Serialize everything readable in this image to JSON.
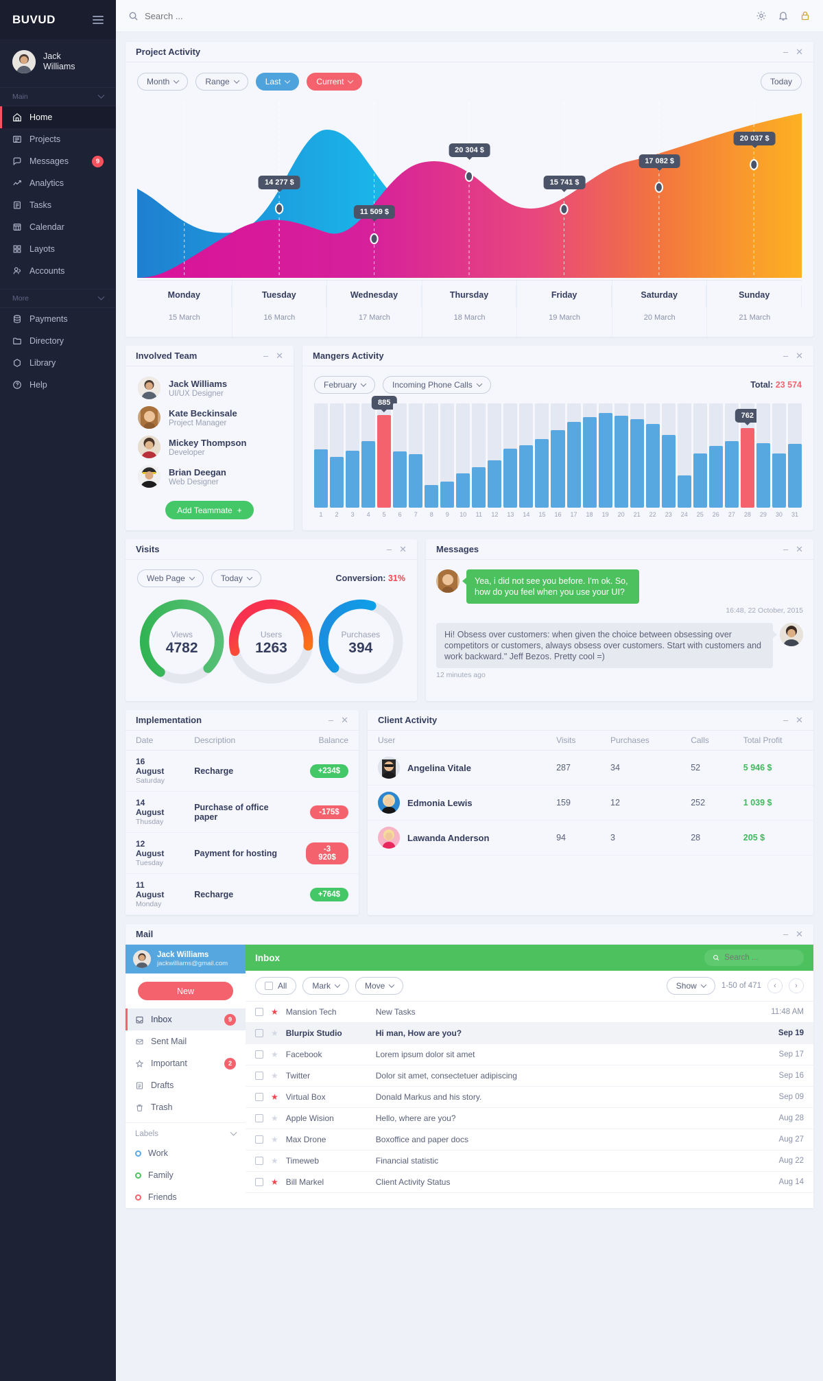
{
  "brand": {
    "logo": "BUVUD"
  },
  "profile": {
    "name": "Jack\nWilliams"
  },
  "sidebar": {
    "section_main": "Main",
    "section_more": "More",
    "items": [
      {
        "label": "Home",
        "icon": "home-icon",
        "active": true
      },
      {
        "label": "Projects",
        "icon": "projects-icon"
      },
      {
        "label": "Messages",
        "icon": "messages-icon",
        "badge": "9"
      },
      {
        "label": "Analytics",
        "icon": "analytics-icon"
      },
      {
        "label": "Tasks",
        "icon": "tasks-icon"
      },
      {
        "label": "Calendar",
        "icon": "calendar-icon"
      },
      {
        "label": "Layots",
        "icon": "layouts-icon"
      },
      {
        "label": "Accounts",
        "icon": "accounts-icon"
      }
    ],
    "more_items": [
      {
        "label": "Payments",
        "icon": "payments-icon"
      },
      {
        "label": "Directory",
        "icon": "directory-icon"
      },
      {
        "label": "Library",
        "icon": "library-icon"
      },
      {
        "label": "Help",
        "icon": "help-icon"
      }
    ]
  },
  "topbar": {
    "search_placeholder": "Search ...",
    "icons": [
      "gear-icon",
      "bell-icon",
      "lock-icon"
    ]
  },
  "project_activity": {
    "title": "Project Activity",
    "filters": [
      {
        "label": "Month",
        "style": "outline"
      },
      {
        "label": "Range",
        "style": "outline"
      },
      {
        "label": "Last",
        "style": "blue"
      },
      {
        "label": "Current",
        "style": "red"
      }
    ],
    "today_label": "Today"
  },
  "involved_team": {
    "title": "Involved Team",
    "members": [
      {
        "name": "Jack Williams",
        "role": "UI/UX Designer"
      },
      {
        "name": "Kate Beckinsale",
        "role": "Project Manager"
      },
      {
        "name": "Mickey Thompson",
        "role": "Developer"
      },
      {
        "name": "Brian Deegan",
        "role": "Web Designer"
      }
    ],
    "add_label": "Add Teammate"
  },
  "managers_activity": {
    "title": "Mangers Activity",
    "filters": [
      {
        "label": "February"
      },
      {
        "label": "Incoming Phone Calls"
      }
    ],
    "total_label": "Total:",
    "total_value": "23 574"
  },
  "visits": {
    "title": "Visits",
    "filters": [
      {
        "label": "Web Page"
      },
      {
        "label": "Today"
      }
    ],
    "conversion_label": "Conversion:",
    "conversion_value": "31%",
    "donuts": [
      {
        "label": "Views",
        "value": "4782",
        "pct": 78,
        "c1": "#2bb24c",
        "c2": "#5fc27e"
      },
      {
        "label": "Users",
        "value": "1263",
        "pct": 56,
        "c1": "#fb8c00",
        "c2": "#f8314f"
      },
      {
        "label": "Purchases",
        "value": "394",
        "pct": 42,
        "c1": "#00b2f0",
        "c2": "#1a8fe0"
      }
    ]
  },
  "messages": {
    "title": "Messages",
    "items": [
      {
        "side": "right",
        "text": "Yea, i did not see you before. I'm ok. So, how do you feel when you use your UI?",
        "time": "16:48, 22 October, 2015"
      },
      {
        "side": "left",
        "text": "Hi! Obsess over customers: when given the choice between obsessing over competitors or customers, always obsess over customers. Start with customers and work backward.\" Jeff Bezos. Pretty cool =)",
        "time": "12 minutes ago"
      }
    ]
  },
  "implementation": {
    "title": "Implementation",
    "columns": [
      "Date",
      "Description",
      "Balance"
    ],
    "rows": [
      {
        "date": "16 August",
        "day": "Saturday",
        "desc": "Recharge",
        "balance": "+234$",
        "sign": "p"
      },
      {
        "date": "14 August",
        "day": "Thusday",
        "desc": "Purchase of office paper",
        "balance": "-175$",
        "sign": "n"
      },
      {
        "date": "12 August",
        "day": "Tuesday",
        "desc": "Payment for hosting",
        "balance": "-3 920$",
        "sign": "n"
      },
      {
        "date": "11 August",
        "day": "Monday",
        "desc": "Recharge",
        "balance": "+764$",
        "sign": "p"
      }
    ]
  },
  "client_activity": {
    "title": "Client Activity",
    "columns": [
      "User",
      "Visits",
      "Purchases",
      "Calls",
      "Total Profit"
    ],
    "rows": [
      {
        "name": "Angelina Vitale",
        "visits": "287",
        "purchases": "34",
        "calls": "52",
        "profit": "5 946 $"
      },
      {
        "name": "Edmonia Lewis",
        "visits": "159",
        "purchases": "12",
        "calls": "252",
        "profit": "1 039 $"
      },
      {
        "name": "Lawanda Anderson",
        "visits": "94",
        "purchases": "3",
        "calls": "28",
        "profit": "205 $"
      }
    ]
  },
  "mail": {
    "title": "Mail",
    "user_name": "Jack Williams",
    "user_email": "jackwilliams@gmail.com",
    "new_label": "New",
    "folders": [
      {
        "label": "Inbox",
        "icon": "inbox-icon",
        "badge": "9",
        "active": true
      },
      {
        "label": "Sent Mail",
        "icon": "sent-icon"
      },
      {
        "label": "Important",
        "icon": "star-icon",
        "badge": "2"
      },
      {
        "label": "Drafts",
        "icon": "drafts-icon"
      },
      {
        "label": "Trash",
        "icon": "trash-icon"
      }
    ],
    "labels_title": "Labels",
    "labels": [
      {
        "label": "Work",
        "color": "#5aa9e6"
      },
      {
        "label": "Family",
        "color": "#4ec15f"
      },
      {
        "label": "Friends",
        "color": "#f4636d"
      }
    ],
    "inbox_title": "Inbox",
    "search_placeholder": "Search ...",
    "toolbar": [
      {
        "label": "All",
        "type": "checkbox"
      },
      {
        "label": "Mark",
        "type": "dropdown"
      },
      {
        "label": "Move",
        "type": "dropdown"
      }
    ],
    "show_label": "Show",
    "pager_text": "1-50 of 471",
    "rows": [
      {
        "from": "Mansion Tech",
        "subject": "New Tasks",
        "date": "11:48 AM",
        "star": true,
        "unread": false
      },
      {
        "from": "Blurpix Studio",
        "subject": "Hi man, How are you?",
        "date": "Sep 19",
        "star": false,
        "unread": true
      },
      {
        "from": "Facebook",
        "subject": "Lorem ipsum dolor sit amet",
        "date": "Sep 17",
        "star": false,
        "unread": false
      },
      {
        "from": "Twitter",
        "subject": "Dolor sit amet, consectetuer adipiscing",
        "date": "Sep 16",
        "star": false,
        "unread": false
      },
      {
        "from": "Virtual Box",
        "subject": "Donald Markus and his story.",
        "date": "Sep 09",
        "star": true,
        "unread": false
      },
      {
        "from": "Apple Wision",
        "subject": "Hello, where are you?",
        "date": "Aug 28",
        "star": false,
        "unread": false
      },
      {
        "from": "Max Drone",
        "subject": "Boxoffice and paper docs",
        "date": "Aug 27",
        "star": false,
        "unread": false
      },
      {
        "from": "Timeweb",
        "subject": "Financial statistic",
        "date": "Aug 22",
        "star": false,
        "unread": false
      },
      {
        "from": "Bill Markel",
        "subject": "Client Activity Status",
        "date": "Aug 14",
        "star": true,
        "unread": false
      }
    ]
  },
  "chart_data": [
    {
      "type": "area",
      "title": "Project Activity",
      "categories": [
        "Monday",
        "Tuesday",
        "Wednesday",
        "Thursday",
        "Friday",
        "Saturday",
        "Sunday"
      ],
      "subcategories": [
        "15 March",
        "16 March",
        "17 March",
        "18 March",
        "19 March",
        "20 March",
        "21 March"
      ],
      "series": [
        {
          "name": "Last",
          "color": "#1ec7ef",
          "values": [
            11000,
            6500,
            20800,
            14500,
            7000,
            5200,
            4300
          ]
        },
        {
          "name": "Current",
          "color": "#e0309b",
          "values": [
            3200,
            14277,
            11509,
            20304,
            15741,
            17082,
            20037
          ]
        }
      ],
      "labels": [
        "14 277 $",
        "11 509 $",
        "20 304 $",
        "15 741 $",
        "17 082 $",
        "20 037 $"
      ],
      "label_points": [
        {
          "x": 2,
          "text": "14 277 $"
        },
        {
          "x": 3,
          "text": "11 509 $"
        },
        {
          "x": 4,
          "text": "20 304 $"
        },
        {
          "x": 5,
          "text": "15 741 $"
        },
        {
          "x": 6,
          "text": "17 082 $"
        },
        {
          "x": 7,
          "text": "20 037 $"
        }
      ],
      "ylabel": "",
      "xlabel": "",
      "grid": true,
      "legend": "none"
    },
    {
      "type": "bar",
      "title": "Mangers Activity — Incoming Phone Calls, February",
      "categories": [
        "1",
        "2",
        "3",
        "4",
        "5",
        "6",
        "7",
        "8",
        "9",
        "10",
        "11",
        "12",
        "13",
        "14",
        "15",
        "16",
        "17",
        "18",
        "19",
        "20",
        "21",
        "22",
        "23",
        "24",
        "25",
        "26",
        "27",
        "28",
        "29",
        "30",
        "31"
      ],
      "values": [
        560,
        490,
        545,
        640,
        885,
        540,
        510,
        215,
        250,
        330,
        390,
        455,
        565,
        600,
        660,
        745,
        820,
        870,
        905,
        880,
        850,
        800,
        700,
        310,
        520,
        590,
        640,
        762,
        620,
        520,
        610
      ],
      "highlight_indices": [
        4,
        27
      ],
      "annotations": [
        {
          "index": 4,
          "text": "885"
        },
        {
          "index": 27,
          "text": "762"
        }
      ],
      "ymax": 1000,
      "ylabel": "",
      "xlabel": "",
      "grid": true,
      "legend": "none",
      "bar_color": "#57a8e0",
      "highlight_color": "#f4636d"
    },
    {
      "type": "pie",
      "title": "Visits",
      "labels": [
        "Views",
        "Users",
        "Purchases"
      ],
      "values": [
        4782,
        1263,
        394
      ],
      "percent": [
        78,
        56,
        42
      ],
      "colors": [
        "#2bb24c",
        "#fb8c00",
        "#00b2f0"
      ],
      "legend": "center-label"
    }
  ]
}
